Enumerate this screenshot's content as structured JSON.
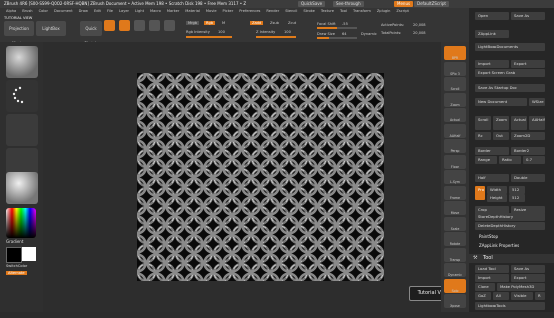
{
  "titlebar": {
    "title": "ZBrush 4R6 [S00-SS99-Q0O2-0RSF-HQBN]    ZBrush Document    • Active Mem 198 • Scratch Disk 198 • Free Mem 3117 • Z",
    "quicksave": "QuickSave",
    "see_through": "See-through",
    "see_through_value": "0",
    "menus_button": "Menus",
    "default_zscript": "DefaultZScript"
  },
  "menubar": {
    "items": [
      "Alpha",
      "Brush",
      "Color",
      "Document",
      "Draw",
      "Edit",
      "File",
      "Layer",
      "Light",
      "Macro",
      "Marker",
      "Material",
      "Movie",
      "Picker",
      "Preferences",
      "Render",
      "Stencil",
      "Stroke",
      "Texture",
      "Tool",
      "Transform",
      "Zplugin",
      "Zscript"
    ]
  },
  "shelf": {
    "projection_master": "Projection Master",
    "lightbox": "LightBox",
    "quick_sketch": "Quick Sketch",
    "tools": [
      "Edit",
      "Draw",
      "Move",
      "Scale",
      "Rotate"
    ],
    "mrgb": "Mrgb",
    "rgb": "Rgb",
    "m": "M",
    "zadd": "Zadd",
    "zsub": "Zsub",
    "zcut": "Zcut",
    "rgb_intensity_label": "Rgb Intensity",
    "rgb_intensity": "100",
    "rgb_intensity_fraction": 1.0,
    "z_intensity_label": "Z Intensity",
    "z_intensity": "100",
    "z_intensity_fraction": 1.0,
    "focal_shift_label": "Focal Shift",
    "focal_shift": "-55",
    "draw_size_label": "Draw Size",
    "draw_size": "64",
    "dynamic": "Dynamic",
    "active_points_label": "ActivePoints:",
    "active_points": "20,008",
    "total_points_label": "TotalPoints:",
    "total_points": "20,008"
  },
  "tutorial_view_label": "TUTORIAL VIEW",
  "left_tray": {
    "gradient": "Gradient",
    "switch_color": "SwitchColor",
    "alternate": "Alternate"
  },
  "right_icons": [
    "BPR",
    "SPix 3",
    "Scroll",
    "Zoom",
    "Actual",
    "AAHalf",
    "Persp",
    "Floor",
    "L.Sym",
    "Frame",
    "Move",
    "Scale",
    "Rotate",
    "Transp",
    "Dynamic",
    "Solo",
    "Xpose"
  ],
  "palette": {
    "open": "Open",
    "save_as": "Save As",
    "zapplink": "ZAppLink",
    "lightbox_documents": "LightBox▸Documents",
    "import": "Import",
    "export": "Export",
    "export_screen_grab": "Export Screen Grab",
    "save_as_startup_doc": "Save As Startup Doc",
    "new_document": "New Document",
    "wsize": "WSize",
    "scroll_labels": [
      "Scroll",
      "Zoom",
      "Actual",
      "AAHalf"
    ],
    "rc": "Rc",
    "out": "Out",
    "zoom_doc": "Zoom2D",
    "range": "Range",
    "border": "Border",
    "border2": "Border2",
    "ratio": "Ratio",
    "ratio_value": "0.7",
    "half": "Half",
    "double": "Double",
    "pro": "Pro",
    "width_label": "Width",
    "width_value": "512",
    "height_label": "Height",
    "height_value": "512",
    "crop": "Crop",
    "resize": "Resize",
    "store_depth_history": "StoreDepthHistory",
    "delete_depth_history": "DeleteDepthHistory",
    "paintstop": "PaintStop",
    "zapplink_properties": "ZAppLink Properties",
    "tool_header": "Tool",
    "load_tool": "Load Tool",
    "save_as_tool": "Save As",
    "copy_tool": "Copy Tool",
    "paste_tool": "Paste Tool",
    "import_tool": "Import",
    "export_tool": "Export",
    "clone": "Clone",
    "make_polymesh3d": "Make PolyMesh3D",
    "goz": "GoZ",
    "all": "All",
    "visible": "Visible",
    "r": "R",
    "lightbox_tools": "Lightbox▸Tools"
  },
  "canvas": {
    "tutorial_view_button": "Tutorial View"
  },
  "colors": {
    "accent": "#e0791b",
    "background": "#2c2c2c",
    "document": "#0a0a0a",
    "chain": "#9a9a9a"
  }
}
